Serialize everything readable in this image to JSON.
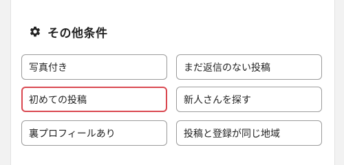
{
  "section": {
    "title": "その他条件",
    "icon": "gear-icon"
  },
  "options": [
    {
      "label": "写真付き",
      "selected": false
    },
    {
      "label": "まだ返信のない投稿",
      "selected": false
    },
    {
      "label": "初めての投稿",
      "selected": true
    },
    {
      "label": "新人さんを探す",
      "selected": false
    },
    {
      "label": "裏プロフィールあり",
      "selected": false
    },
    {
      "label": "投稿と登録が同じ地域",
      "selected": false
    }
  ],
  "colors": {
    "selected_border": "#d9474f",
    "default_border": "#9a9a9a",
    "text": "#222222"
  }
}
